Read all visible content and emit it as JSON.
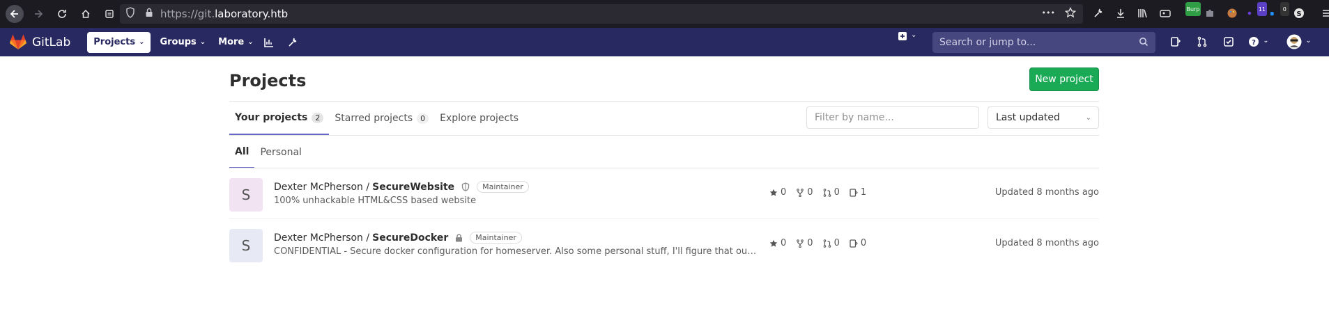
{
  "browser": {
    "url_proto": "https://",
    "url_host_prefix": "git.",
    "url_host": "laboratory.htb",
    "menu_dots": "•••",
    "ext_burp_label": "Burp",
    "ext_badge1": "11",
    "ext_badge2": "0"
  },
  "nav": {
    "logo_text": "GitLab",
    "projects_label": "Projects",
    "groups_label": "Groups",
    "more_label": "More",
    "search_placeholder": "Search or jump to..."
  },
  "page": {
    "title": "Projects",
    "new_project_label": "New project",
    "tabs": [
      {
        "label": "Your projects",
        "count": "2"
      },
      {
        "label": "Starred projects",
        "count": "0"
      },
      {
        "label": "Explore projects"
      }
    ],
    "filter_placeholder": "Filter by name...",
    "sort_label": "Last updated",
    "subtabs": [
      {
        "label": "All"
      },
      {
        "label": "Personal"
      }
    ]
  },
  "projects": [
    {
      "avatar_letter": "S",
      "avatar_bg": "#f2e3f3",
      "namespace": "Dexter McPherson / ",
      "name": "SecureWebsite",
      "visibility": "internal",
      "role": "Maintainer",
      "description": "100% unhackable HTML&CSS based website",
      "stars": "0",
      "forks": "0",
      "merge_requests": "0",
      "issues": "1",
      "updated": "Updated 8 months ago"
    },
    {
      "avatar_letter": "S",
      "avatar_bg": "#e7e9f4",
      "namespace": "Dexter McPherson / ",
      "name": "SecureDocker",
      "visibility": "private",
      "role": "Maintainer",
      "description": "CONFIDENTIAL - Secure docker configuration for homeserver. Also some personal stuff, I'll figure that out later.",
      "stars": "0",
      "forks": "0",
      "merge_requests": "0",
      "issues": "0",
      "updated": "Updated 8 months ago"
    }
  ],
  "colors": {
    "nav_bg": "#292961",
    "accent": "#6666c4",
    "success": "#1aaa55"
  }
}
